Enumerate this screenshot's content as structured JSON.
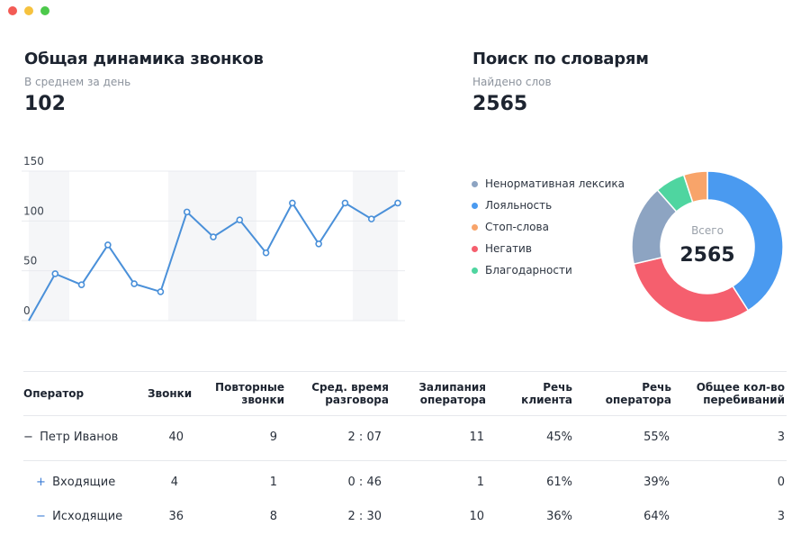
{
  "calls": {
    "title": "Общая динамика звонков",
    "subtitle": "В среднем за день",
    "value": "102"
  },
  "dictionary": {
    "title": "Поиск по словарям",
    "subtitle": "Найдено слов",
    "value": "2565"
  },
  "chart_data": [
    {
      "type": "line",
      "title": "",
      "xlabel": "",
      "ylabel": "",
      "ylim": [
        0,
        150
      ],
      "yticks": [
        "150",
        "100",
        "50",
        "0"
      ],
      "grid": true,
      "series": [
        {
          "values": [
            0,
            47,
            36,
            76,
            37,
            29,
            109,
            84,
            101,
            68,
            118,
            77,
            118,
            102,
            118
          ],
          "color": "#4a90d9"
        }
      ]
    },
    {
      "type": "pie",
      "title": "",
      "center_label": "Всего",
      "center_value": "2565",
      "legend": "left",
      "slices": [
        {
          "name": "Лояльность",
          "value": 1050,
          "color": "#4a9af0"
        },
        {
          "name": "Негатив",
          "value": 780,
          "color": "#f55f6e"
        },
        {
          "name": "Ненормативная лексика",
          "value": 440,
          "color": "#8da4c2"
        },
        {
          "name": "Благодарности",
          "value": 165,
          "color": "#4fd5a0"
        },
        {
          "name": "Стоп-слова",
          "value": 130,
          "color": "#f8a46a"
        }
      ]
    }
  ],
  "legend": [
    {
      "label": "Ненормативная лексика",
      "color": "#8da4c2"
    },
    {
      "label": "Лояльность",
      "color": "#4a9af0"
    },
    {
      "label": "Стоп-слова",
      "color": "#f8a46a"
    },
    {
      "label": "Негатив",
      "color": "#f55f6e"
    },
    {
      "label": "Благодарности",
      "color": "#4fd5a0"
    }
  ],
  "table": {
    "headers": {
      "operator": "Оператор",
      "calls": "Звонки",
      "repeat_1": "Повторные",
      "repeat_2": "звонки",
      "avg_1": "Сред. время",
      "avg_2": "разговора",
      "stuck_1": "Залипания",
      "stuck_2": "оператора",
      "client_1": "Речь",
      "client_2": "клиента",
      "opspeech_1": "Речь",
      "opspeech_2": "оператора",
      "interrupt_1": "Общее кол-во",
      "interrupt_2": "перебиваний"
    },
    "rows": [
      {
        "toggle": "−",
        "name": "Петр Иванов",
        "calls": "40",
        "repeat": "9",
        "avg": "2 : 07",
        "stuck": "11",
        "client": "45%",
        "opspeech": "55%",
        "interrupt": "3"
      },
      {
        "toggle": "+",
        "name": "Входящие",
        "calls": "4",
        "repeat": "1",
        "avg": "0 : 46",
        "stuck": "1",
        "client": "61%",
        "opspeech": "39%",
        "interrupt": "0"
      },
      {
        "toggle": "−",
        "name": "Исходящие",
        "calls": "36",
        "repeat": "8",
        "avg": "2 : 30",
        "stuck": "10",
        "client": "36%",
        "opspeech": "64%",
        "interrupt": "3"
      }
    ]
  }
}
